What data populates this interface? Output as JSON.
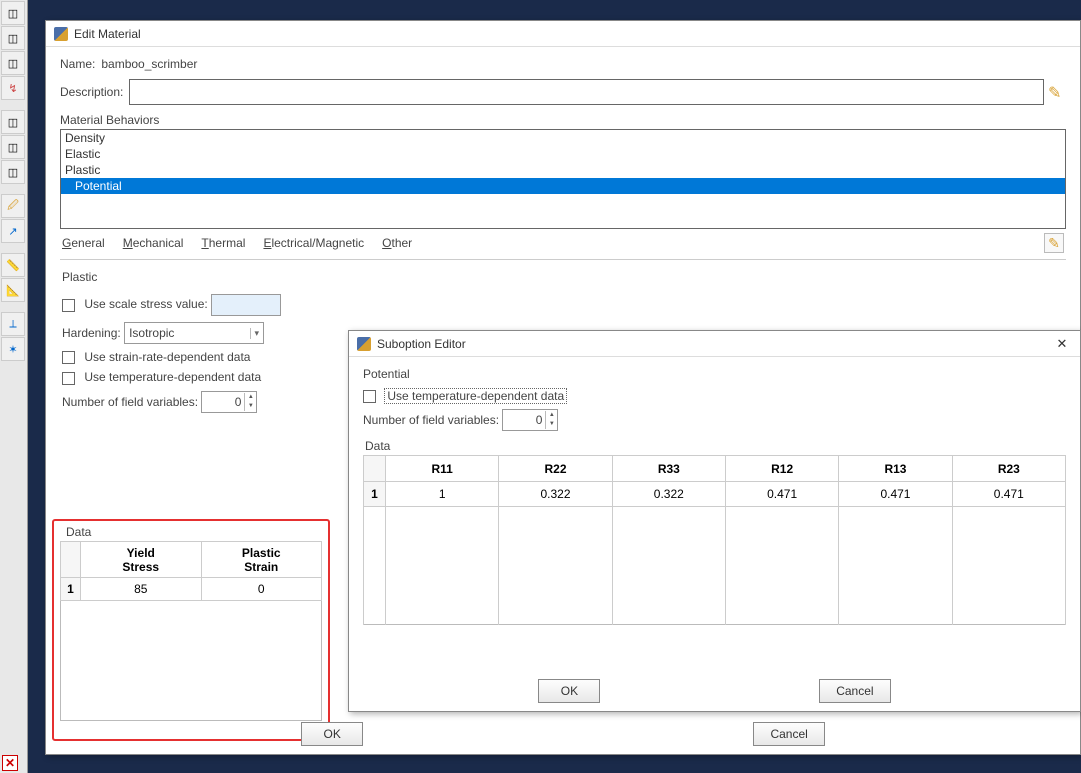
{
  "editMaterial": {
    "title": "Edit Material",
    "nameLabel": "Name:",
    "nameValue": "bamboo_scrimber",
    "descLabel": "Description:",
    "descValue": "",
    "behaviorsLabel": "Material Behaviors",
    "behaviors": [
      "Density",
      "Elastic",
      "Plastic",
      "Potential"
    ],
    "behaviorSelectedIndex": 3,
    "menus": {
      "general": "General",
      "mechanical": "Mechanical",
      "thermal": "Thermal",
      "electrical": "Electrical/Magnetic",
      "other": "Other"
    },
    "plastic": {
      "heading": "Plastic",
      "useScaleStressLabel": "Use scale stress value:",
      "scaleStressValue": "",
      "hardeningLabel": "Hardening:",
      "hardeningValue": "Isotropic",
      "useStrainRateLabel": "Use strain-rate-dependent data",
      "useTempLabel": "Use temperature-dependent data",
      "numFieldVarLabel": "Number of field variables:",
      "numFieldVarValue": "0",
      "dataLabel": "Data",
      "columns": [
        "Yield\nStress",
        "Plastic\nStrain"
      ],
      "rows": [
        {
          "n": "1",
          "c1": "85",
          "c2": "0"
        }
      ]
    },
    "okLabel": "OK",
    "cancelLabel": "Cancel"
  },
  "suboption": {
    "title": "Suboption Editor",
    "heading": "Potential",
    "useTempLabel": "Use temperature-dependent data",
    "numFieldVarLabel": "Number of field variables:",
    "numFieldVarValue": "0",
    "dataLabel": "Data",
    "columns": [
      "R11",
      "R22",
      "R33",
      "R12",
      "R13",
      "R23"
    ],
    "rows": [
      {
        "n": "1",
        "v": [
          "1",
          "0.322",
          "0.322",
          "0.471",
          "0.471",
          "0.471"
        ]
      }
    ],
    "okLabel": "OK",
    "cancelLabel": "Cancel"
  },
  "chart_data": {
    "type": "table",
    "title": "Potential suboption R-values",
    "columns": [
      "R11",
      "R22",
      "R33",
      "R12",
      "R13",
      "R23"
    ],
    "rows": [
      [
        1,
        0.322,
        0.322,
        0.471,
        0.471,
        0.471
      ]
    ]
  }
}
